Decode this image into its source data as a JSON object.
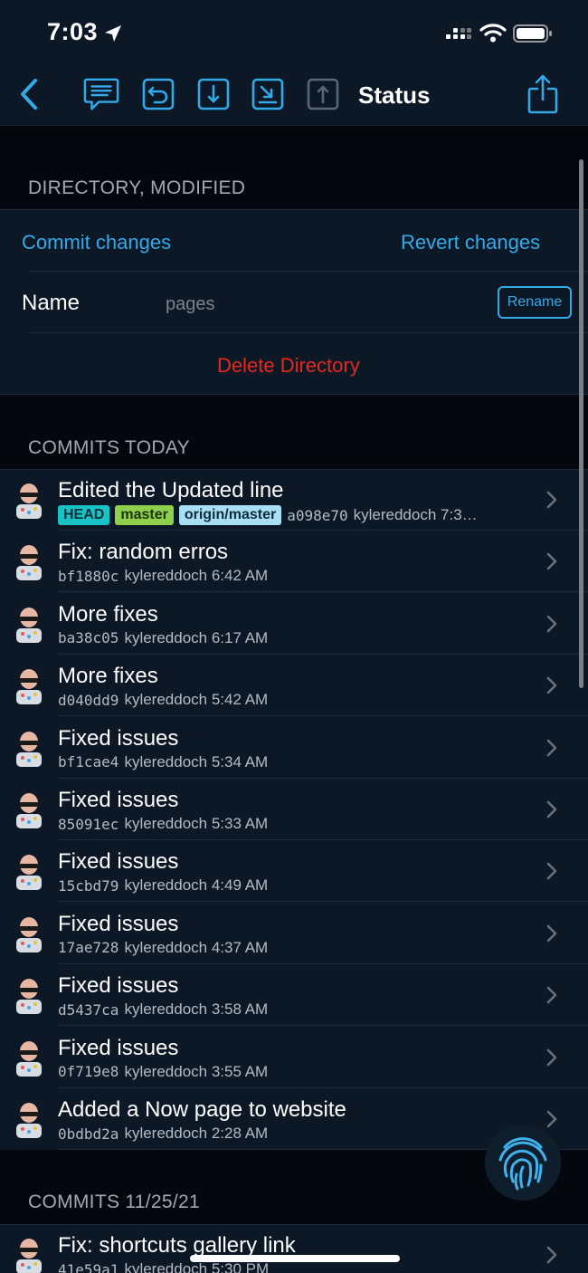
{
  "status_bar": {
    "time": "7:03"
  },
  "nav": {
    "title": "Status"
  },
  "directory": {
    "header": "DIRECTORY, MODIFIED",
    "commit_label": "Commit changes",
    "revert_label": "Revert changes",
    "name_label": "Name",
    "name_value": "pages",
    "rename_label": "Rename",
    "delete_label": "Delete Directory"
  },
  "commits_today": {
    "header": "COMMITS TODAY",
    "items": [
      {
        "title": "Edited the Updated line",
        "hash": "a098e70",
        "info": "kylereddoch 7:3…",
        "badges": [
          "HEAD",
          "master",
          "origin/master"
        ]
      },
      {
        "title": "Fix: random erros",
        "hash": "bf1880c",
        "info": "kylereddoch 6:42 AM"
      },
      {
        "title": "More fixes",
        "hash": "ba38c05",
        "info": "kylereddoch 6:17 AM"
      },
      {
        "title": "More fixes",
        "hash": "d040dd9",
        "info": "kylereddoch 5:42 AM"
      },
      {
        "title": "Fixed issues",
        "hash": "bf1cae4",
        "info": "kylereddoch 5:34 AM"
      },
      {
        "title": "Fixed issues",
        "hash": "85091ec",
        "info": "kylereddoch 5:33 AM"
      },
      {
        "title": "Fixed issues",
        "hash": "15cbd79",
        "info": "kylereddoch 4:49 AM"
      },
      {
        "title": "Fixed issues",
        "hash": "17ae728",
        "info": "kylereddoch 4:37 AM"
      },
      {
        "title": "Fixed issues",
        "hash": "d5437ca",
        "info": "kylereddoch 3:58 AM"
      },
      {
        "title": "Fixed issues",
        "hash": "0f719e8",
        "info": "kylereddoch 3:55 AM"
      },
      {
        "title": "Added a Now page to website",
        "hash": "0bdbd2a",
        "info": "kylereddoch 2:28 AM"
      }
    ]
  },
  "commits_prev": {
    "header": "COMMITS 11/25/21",
    "items": [
      {
        "title": "Fix: shortcuts gallery link",
        "hash": "41e59a1",
        "info": "kylereddoch 5:30 PM"
      }
    ]
  },
  "colors": {
    "accent": "#33a9e8",
    "danger": "#e5281e",
    "background": "#04080e",
    "surface": "#0d1826"
  },
  "icons": {
    "back": "chevron-left-icon",
    "chat": "chat-bubble-icon",
    "undo": "undo-icon",
    "download": "download-icon",
    "save": "save-icon",
    "upload": "upload-icon",
    "share": "share-icon",
    "fingerprint": "fingerprint-icon"
  }
}
